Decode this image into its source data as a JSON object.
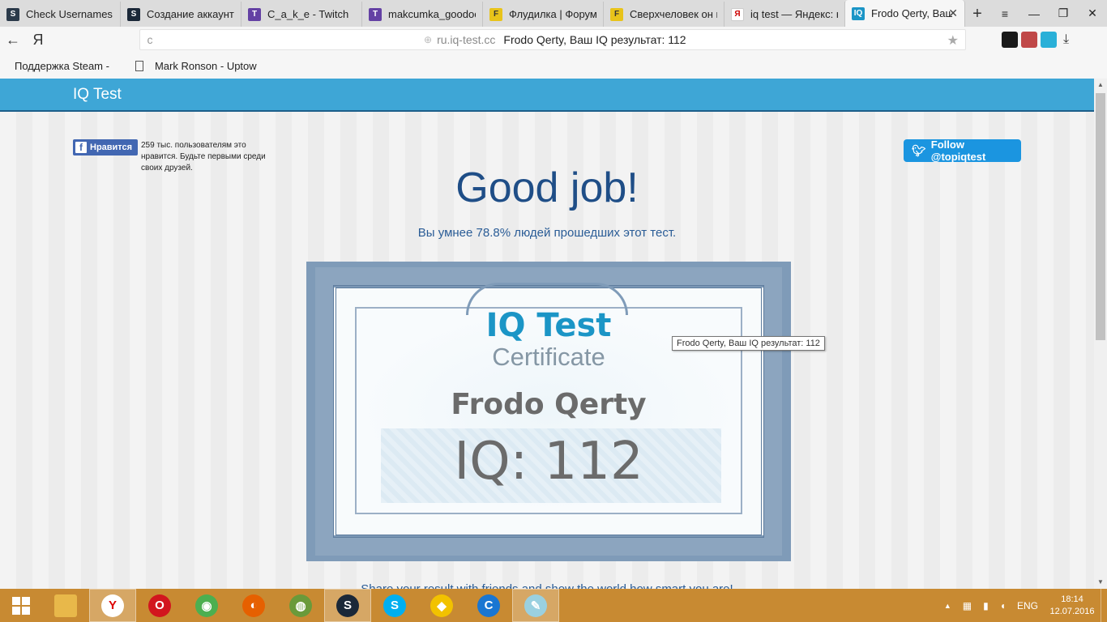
{
  "browser": {
    "tabs": [
      {
        "label": "Check Usernames -",
        "favicon_color": "#2b3a4a",
        "favicon": "S"
      },
      {
        "label": "Создание аккаунта",
        "favicon_color": "#1b2838",
        "favicon": "S"
      },
      {
        "label": "C_a_k_e - Twitch",
        "favicon_color": "#6441a4",
        "favicon": "T"
      },
      {
        "label": "makcumka_goodoc",
        "favicon_color": "#6441a4",
        "favicon": "T"
      },
      {
        "label": "Флудилка | Форум",
        "favicon_color": "#e8c31a",
        "favicon": "F"
      },
      {
        "label": "Сверхчеловек он н",
        "favicon_color": "#e8c31a",
        "favicon": "F"
      },
      {
        "label": "iq test — Яндекс: н",
        "favicon_color": "#ffffff",
        "favicon": "Я"
      },
      {
        "label": "Frodo Qerty, Ваш",
        "favicon_color": "#1b95c6",
        "favicon": "IQ",
        "active": true
      }
    ],
    "new_tab": "+",
    "window_controls": {
      "menu": "≡",
      "minimize": "—",
      "restore": "❐",
      "close": "✕"
    },
    "back": "←",
    "yandex": "Я",
    "reload": "c",
    "url_domain": "ru.iq-test.cc",
    "url_title": "Frodo Qerty, Ваш IQ результат: 112",
    "star": "★",
    "download": "⤓",
    "bookmarks": [
      {
        "label": "Поддержка Steam - ",
        "icon": "none"
      },
      {
        "label": "Mark Ronson - Uptow",
        "icon": "doc"
      }
    ]
  },
  "site": {
    "brand": "IQ Test",
    "fb_like_label": "Нравится",
    "fb_like_icon": "f",
    "fb_text": "259 тыс. пользователям это нравится. Будьте первыми среди своих друзей.",
    "twitter_label": "Follow @topiqtest",
    "heading": "Good job!",
    "smarter_than": "Вы умнее 78.8% людей прошедших этот тест.",
    "certificate": {
      "title": "IQ Test",
      "subtitle": "Certificate",
      "name": "Frodo Qerty",
      "iq": "IQ: 112"
    },
    "tooltip": "Frodo Qerty, Ваш IQ результат: 112",
    "share_text": "Share your result with friends and show the world how smart you are!"
  },
  "taskbar": {
    "apps": [
      {
        "name": "file-explorer",
        "color": "#e8b84a",
        "glyph": ""
      },
      {
        "name": "yandex-browser",
        "color": "#ffffff",
        "glyph": "Y",
        "active": true
      },
      {
        "name": "opera",
        "color": "#d2161e",
        "glyph": "O"
      },
      {
        "name": "chrome",
        "color": "#4caf50",
        "glyph": "◉"
      },
      {
        "name": "firefox",
        "color": "#e66000",
        "glyph": "◐"
      },
      {
        "name": "globe-app",
        "color": "#6a9a3a",
        "glyph": "◍"
      },
      {
        "name": "steam",
        "color": "#1b2838",
        "glyph": "S",
        "active": true
      },
      {
        "name": "skype",
        "color": "#00aff0",
        "glyph": "S"
      },
      {
        "name": "pizza-app",
        "color": "#f2c200",
        "glyph": "◆"
      },
      {
        "name": "ccleaner-app",
        "color": "#1976d2",
        "glyph": "C"
      },
      {
        "name": "notepad-app",
        "color": "#9ad0e0",
        "glyph": "✎",
        "active": true
      }
    ],
    "tray": {
      "arrow": "▲",
      "lang": "ENG",
      "time": "18:14",
      "date": "12.07.2016"
    }
  }
}
